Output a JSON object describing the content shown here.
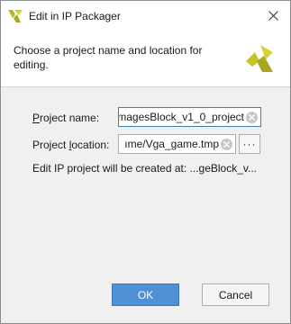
{
  "window": {
    "title": "Edit in IP Packager",
    "close_glyph": "✕"
  },
  "header": {
    "description": "Choose a project name and location for editing.",
    "logo_icon": "vivado-logo-icon"
  },
  "form": {
    "project_name": {
      "label_mnemonic": "P",
      "label_rest": "roject name:",
      "value": "magesBlock_v1_0_project"
    },
    "project_location": {
      "label_pre": "Project ",
      "label_mnemonic": "l",
      "label_rest": "ocation:",
      "value": "ıme/Vga_game.tmp",
      "browse_label": "···"
    },
    "info_text": "Edit IP project will be created at: ...geBlock_v..."
  },
  "buttons": {
    "ok": "OK",
    "cancel": "Cancel"
  },
  "colors": {
    "primary": "#4f8fd6",
    "logo_yellow": "#c6c22a"
  }
}
